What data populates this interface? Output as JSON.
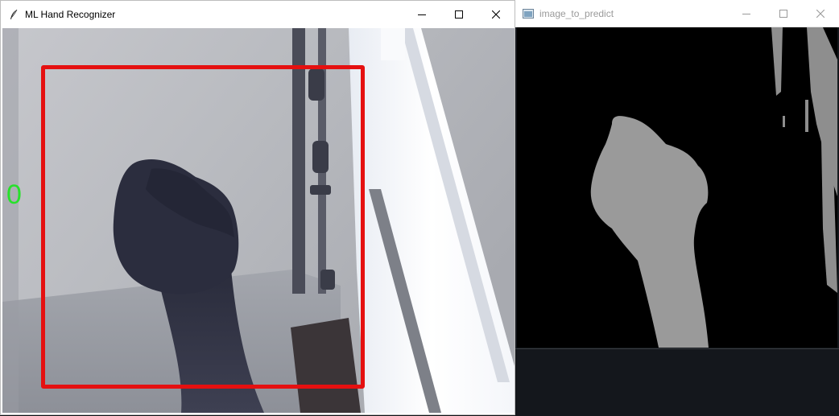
{
  "main_window": {
    "title": "ML Hand Recognizer",
    "icon": "feather-icon",
    "controls": [
      "minimize-icon",
      "maximize-icon",
      "close-icon"
    ]
  },
  "camera_view": {
    "prediction_label": "0",
    "prediction_color": "#27e12b",
    "roi_box_color": "#e51010"
  },
  "predict_window": {
    "title": "image_to_predict",
    "icon": "image-window-icon",
    "controls": [
      "minimize-icon",
      "maximize-icon",
      "close-icon"
    ],
    "mask_color": "#9a9a9a",
    "background_color": "#000000"
  }
}
